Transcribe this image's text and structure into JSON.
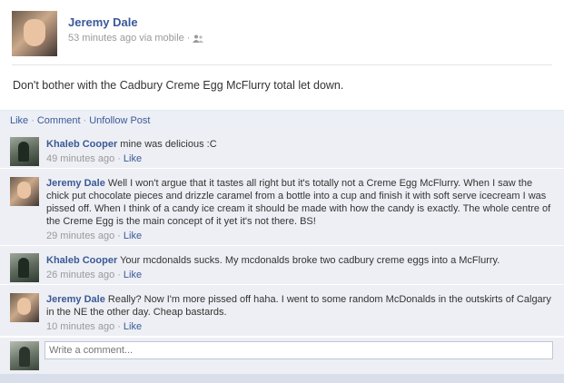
{
  "post": {
    "author": "Jeremy Dale",
    "time": "53 minutes ago via mobile",
    "audience_icon": "friends-icon",
    "text": "Don't bother with the Cadbury Creme Egg McFlurry total let down."
  },
  "actions": {
    "like": "Like",
    "comment": "Comment",
    "unfollow": "Unfollow Post"
  },
  "comments": [
    {
      "author": "Khaleb Cooper",
      "text": "mine was delicious :C",
      "time": "49 minutes ago",
      "like": "Like"
    },
    {
      "author": "Jeremy Dale",
      "text": "Well I won't argue that it tastes all right but it's totally not a Creme Egg McFlurry. When I saw the chick put chocolate pieces and drizzle caramel from a bottle into a cup and finish it with soft serve icecream I was pissed off. When I think of a candy ice cream it should be made with how the candy is exactly. The whole centre of the Creme Egg is the main concept of it yet it's not there. BS!",
      "time": "29 minutes ago",
      "like": "Like"
    },
    {
      "author": "Khaleb Cooper",
      "text": "Your mcdonalds sucks. My mcdonalds broke two cadbury creme eggs into a McFlurry.",
      "time": "26 minutes ago",
      "like": "Like"
    },
    {
      "author": "Jeremy Dale",
      "text": "Really? Now I'm more pissed off haha. I went to some random McDonalds in the outskirts of Calgary in the NE the other day. Cheap bastards.",
      "time": "10 minutes ago",
      "like": "Like"
    }
  ],
  "composer": {
    "placeholder": "Write a comment..."
  },
  "colors": {
    "link": "#3b5998",
    "comment_bg": "#edeff4",
    "meta": "#999999"
  }
}
